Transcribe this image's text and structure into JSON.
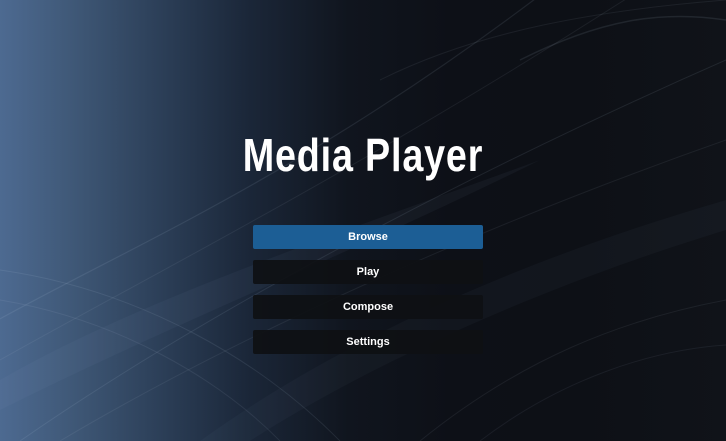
{
  "app": {
    "title": "Media Player"
  },
  "menu": {
    "items": [
      {
        "label": "Browse",
        "selected": true
      },
      {
        "label": "Play",
        "selected": false
      },
      {
        "label": "Compose",
        "selected": false
      },
      {
        "label": "Settings",
        "selected": false
      }
    ]
  },
  "colors": {
    "selected_item": "#1c5e95",
    "item_background": "#0e1014",
    "text": "#ffffff"
  }
}
